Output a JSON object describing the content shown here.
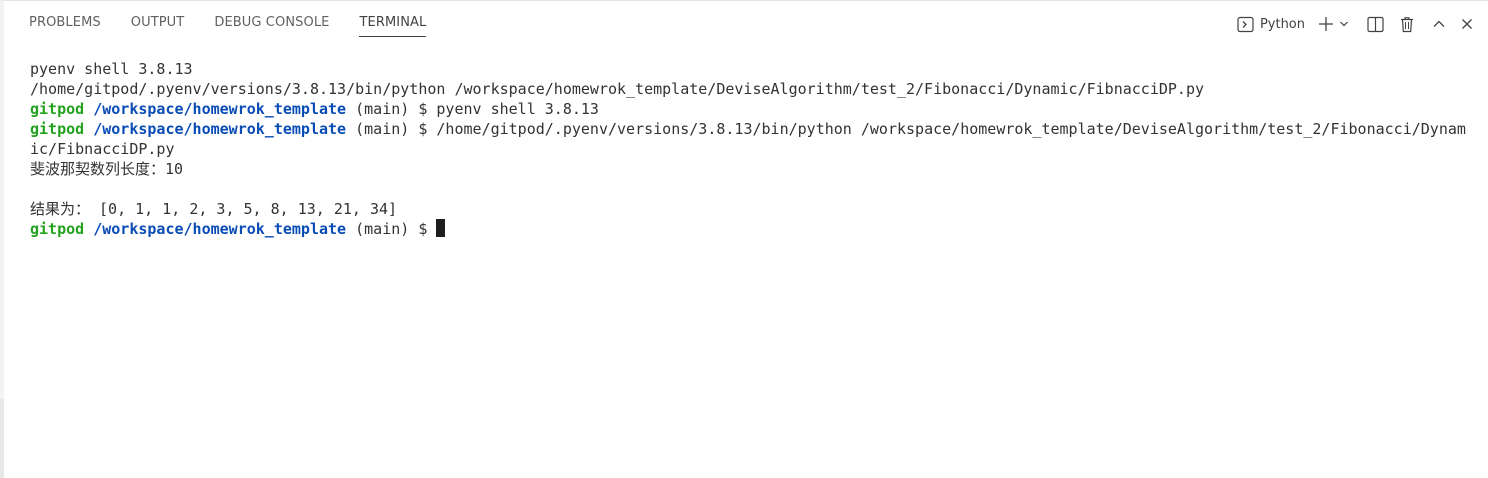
{
  "panel": {
    "tabs": [
      {
        "label": "PROBLEMS"
      },
      {
        "label": "OUTPUT"
      },
      {
        "label": "DEBUG CONSOLE"
      },
      {
        "label": "TERMINAL"
      }
    ],
    "terminal_kind": "Python"
  },
  "terminal": {
    "lines": [
      "pyenv shell 3.8.13",
      "/home/gitpod/.pyenv/versions/3.8.13/bin/python /workspace/homewrok_template/DeviseAlgorithm/test_2/Fibonacci/Dynamic/FibnacciDP.py"
    ],
    "prompt_user": "gitpod",
    "prompt_path": "/workspace/homewrok_template",
    "prompt_suffix": " (main) $ ",
    "cmd1": "pyenv shell 3.8.13",
    "cmd2": "/home/gitpod/.pyenv/versions/3.8.13/bin/python /workspace/homewrok_template/DeviseAlgorithm/test_2/Fibonacci/Dynam",
    "cmd2_cont": "ic/FibnacciDP.py",
    "output1": "斐波那契数列长度：10",
    "output2": "结果为： [0, 1, 1, 2, 3, 5, 8, 13, 21, 34]"
  },
  "colors": {
    "prompt_user": "#23a11f",
    "prompt_path": "#0a4cb5",
    "text": "#333333"
  },
  "icons": {
    "terminal_kind": "terminal-prompt-icon",
    "new_terminal": "plus-icon",
    "dropdown": "chevron-down-icon",
    "split": "split-icon",
    "kill": "trash-icon",
    "maximize": "chevron-up-icon",
    "close": "close-icon"
  }
}
